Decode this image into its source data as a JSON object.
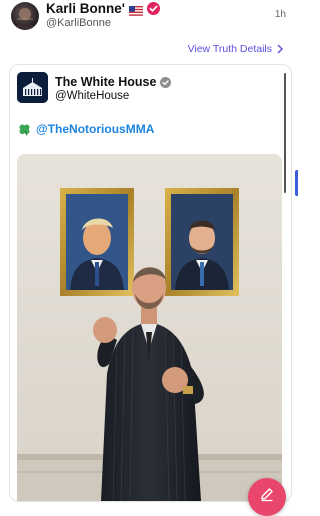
{
  "post": {
    "author_name": "Karli Bonne'",
    "author_handle": "@KarliBonne",
    "time": "1h",
    "flag_icon": "us-flag-icon",
    "verified_icon": "red-verified-icon",
    "view_details_label": "View Truth Details"
  },
  "quoted": {
    "name": "The White House",
    "handle": "@WhiteHouse",
    "mention": "@TheNotoriousMMA",
    "emoji": "four-leaf-clover-icon"
  },
  "colors": {
    "link": "#5a4fe0",
    "mention": "#1d84e0",
    "fab": "#e8466a",
    "verified_red": "#e0245e"
  },
  "compose_icon": "pencil-icon"
}
